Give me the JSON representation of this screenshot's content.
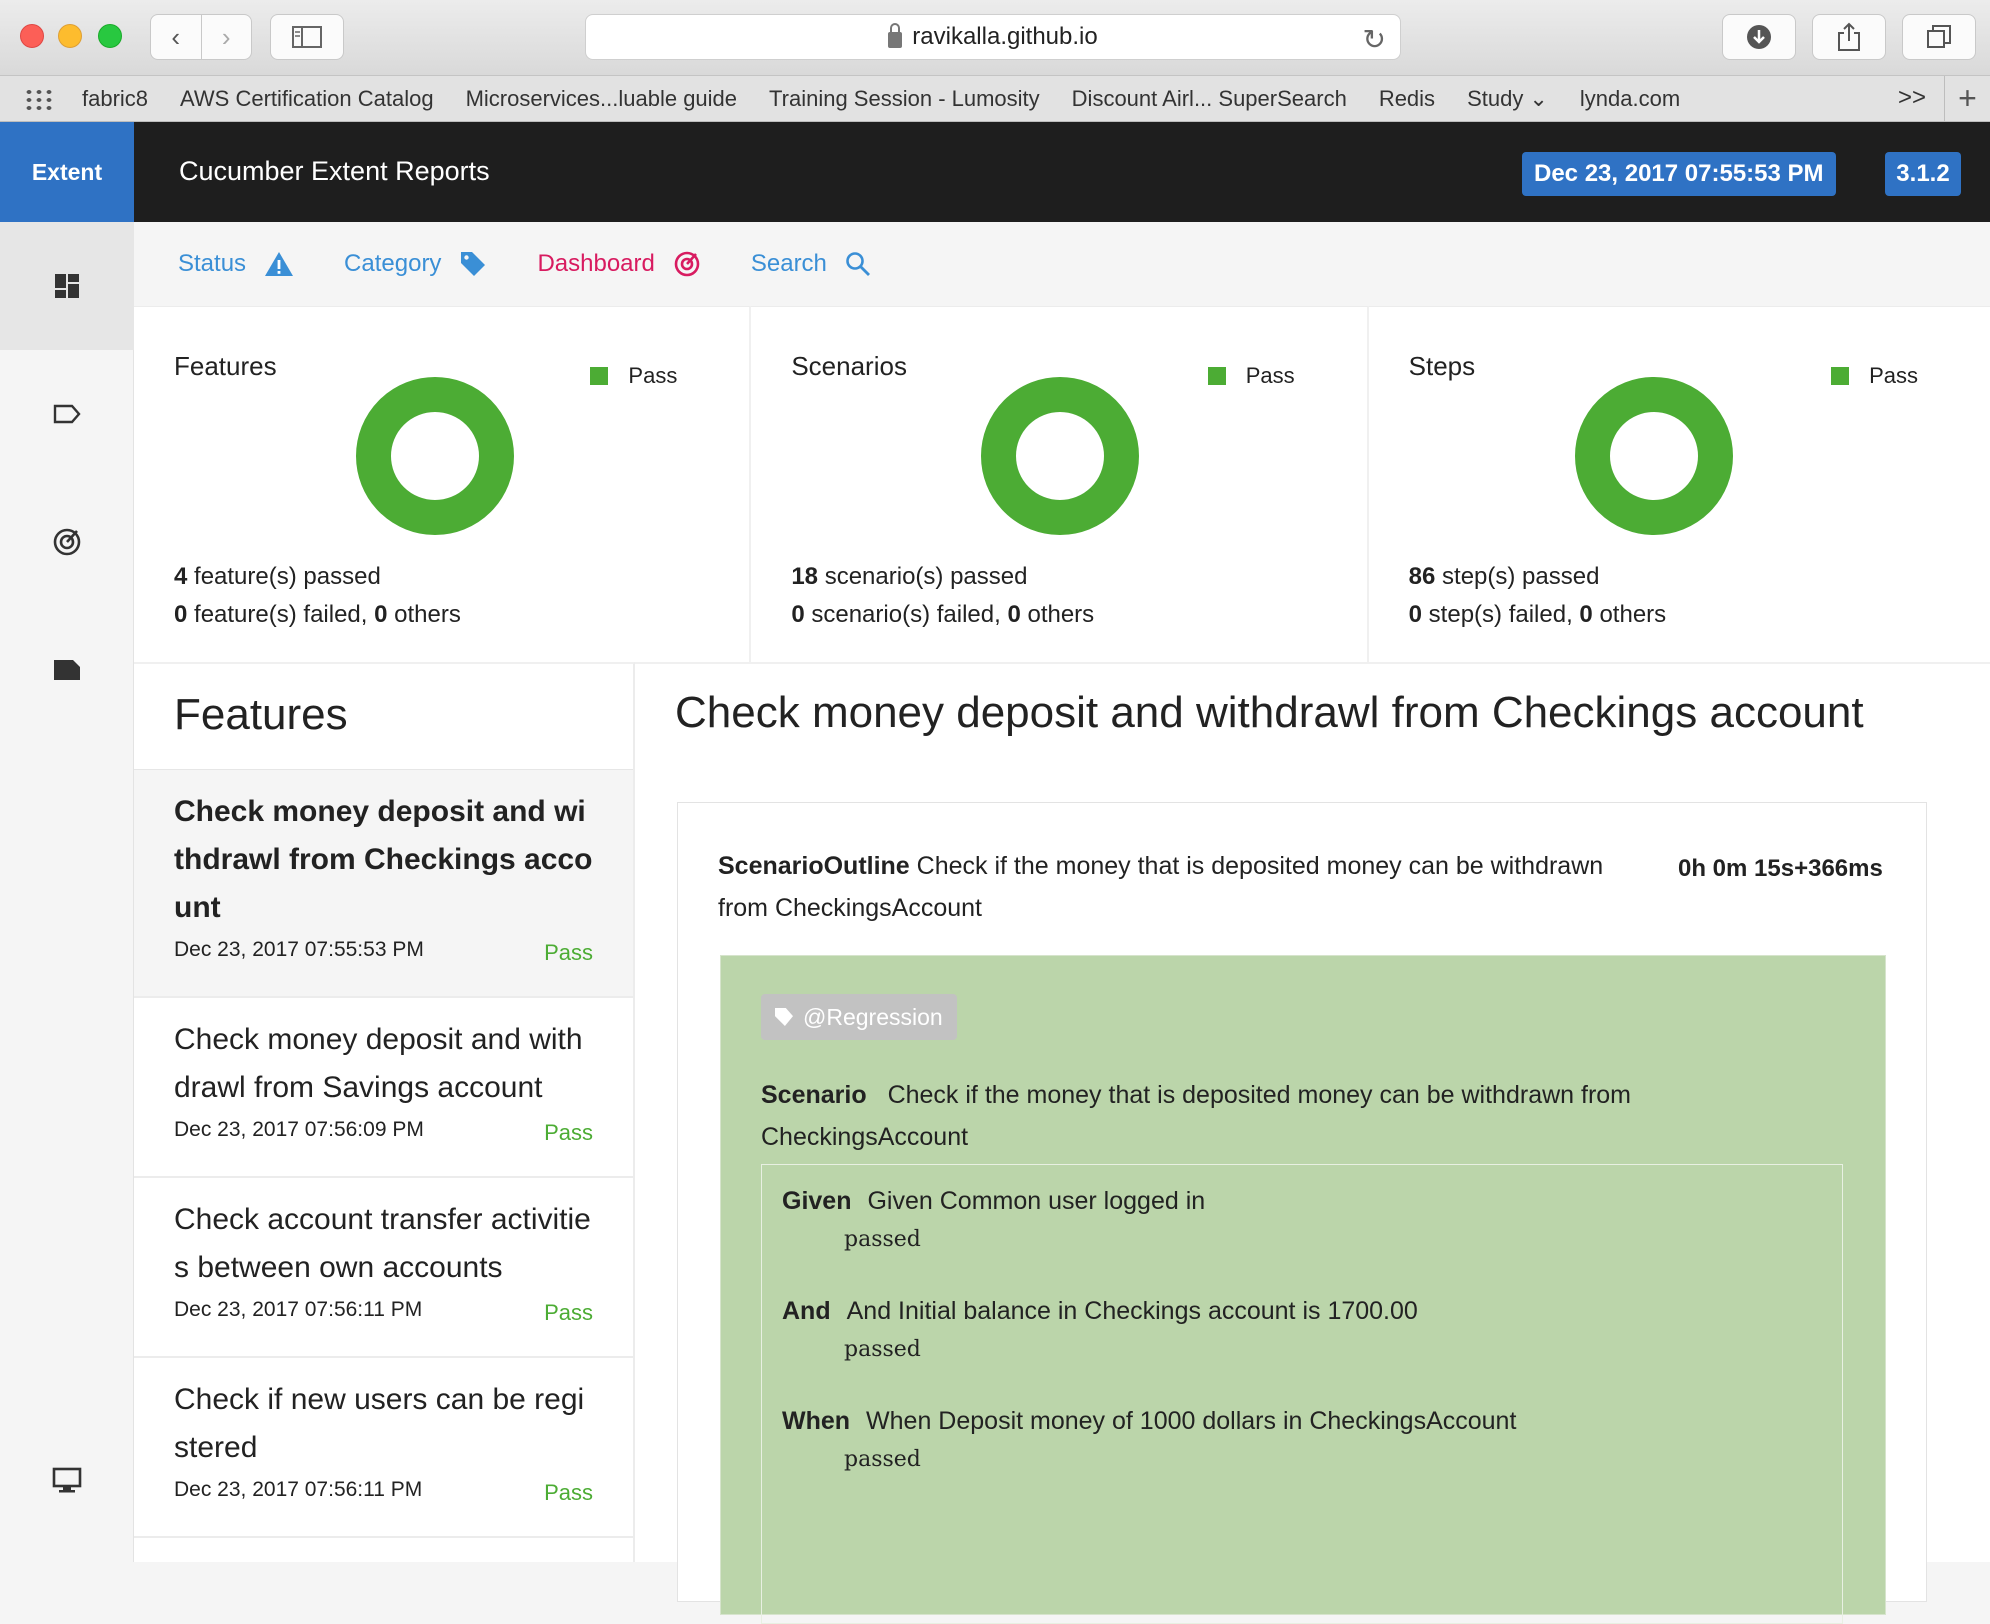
{
  "browser": {
    "url": "ravikalla.github.io",
    "bookmarks": [
      "fabric8",
      "AWS Certification Catalog",
      "Microservices...luable guide",
      "Training Session - Lumosity",
      "Discount Airl... SuperSearch",
      "Redis",
      "Study ⌄",
      "lynda.com"
    ],
    "more": ">>",
    "plus": "+"
  },
  "header": {
    "brand": "Extent",
    "title": "Cucumber Extent Reports",
    "date": "Dec 23, 2017 07:55:53 PM",
    "version": "3.1.2"
  },
  "tabs": {
    "status": "Status",
    "category": "Category",
    "dashboard": "Dashboard",
    "search": "Search"
  },
  "cards": [
    {
      "title": "Features",
      "legend": "Pass",
      "passed_count": "4",
      "passed_label": " feature(s) passed",
      "failed_count": "0",
      "failed_label": " feature(s) failed, ",
      "others_count": "0",
      "others_label": " others"
    },
    {
      "title": "Scenarios",
      "legend": "Pass",
      "passed_count": "18",
      "passed_label": " scenario(s) passed",
      "failed_count": "0",
      "failed_label": " scenario(s) failed, ",
      "others_count": "0",
      "others_label": " others"
    },
    {
      "title": "Steps",
      "legend": "Pass",
      "passed_count": "86",
      "passed_label": " step(s) passed",
      "failed_count": "0",
      "failed_label": " step(s) failed, ",
      "others_count": "0",
      "others_label": " others"
    }
  ],
  "colors": {
    "pass": "#4cac34",
    "accent": "#2f72c4",
    "dashboard": "#d81b60",
    "scenario_bg": "#bbd5aa"
  },
  "features": {
    "heading": "Features",
    "items": [
      {
        "name": "Check money deposit and withdrawl from Checkings account",
        "date": "Dec 23, 2017 07:55:53 PM",
        "status": "Pass"
      },
      {
        "name": "Check money deposit and withdrawl from Savings account",
        "date": "Dec 23, 2017 07:56:09 PM",
        "status": "Pass"
      },
      {
        "name": "Check account transfer activities between own accounts",
        "date": "Dec 23, 2017 07:56:11 PM",
        "status": "Pass"
      },
      {
        "name": "Check if new users can be registered",
        "date": "Dec 23, 2017 07:56:11 PM",
        "status": "Pass"
      }
    ]
  },
  "detail": {
    "title": "Check money deposit and withdrawl from Checkings account",
    "outline_keyword": "ScenarioOutline",
    "outline_name": "Check if the money that is deposited money can be withdrawn from CheckingsAccount",
    "duration": "0h 0m 15s+366ms",
    "tag": "@Regression",
    "scenario_keyword": "Scenario",
    "scenario_name": "Check if the money that is deposited money can be withdrawn from CheckingsAccount",
    "steps": [
      {
        "keyword": "Given",
        "text": "Given Common user logged in",
        "status": "passed"
      },
      {
        "keyword": "And",
        "text": "And Initial balance in Checkings account is 1700.00",
        "status": "passed"
      },
      {
        "keyword": "When",
        "text": "When Deposit money of 1000 dollars in CheckingsAccount",
        "status": "passed"
      }
    ]
  }
}
